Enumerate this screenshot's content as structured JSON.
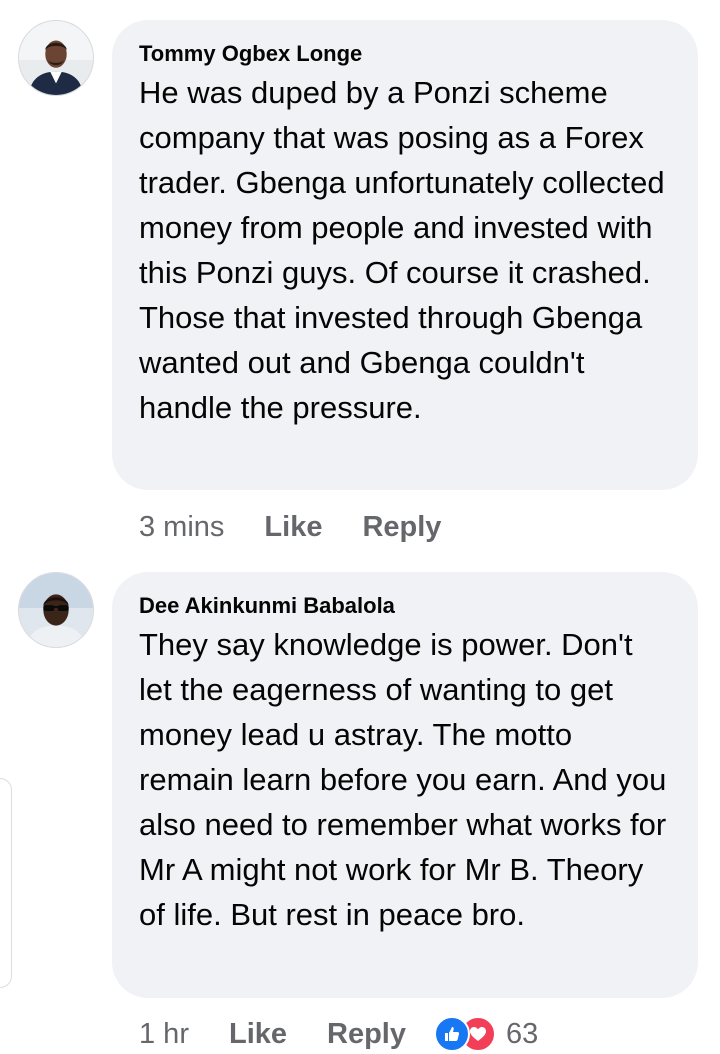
{
  "comments": [
    {
      "author": "Tommy Ogbex Longe",
      "text": "He was duped by a Ponzi scheme company that was posing as a Forex trader. Gbenga unfortunately collected money from people and invested with this Ponzi guys. Of course it crashed. Those that invested through Gbenga wanted out and Gbenga couldn't handle the pressure.",
      "time": "3 mins",
      "like_label": "Like",
      "reply_label": "Reply"
    },
    {
      "author": "Dee Akinkunmi Babalola",
      "text": "They say knowledge is power. Don't let the eagerness of wanting to get money lead u astray. The motto remain learn before you earn. And you also need to remember what works for Mr A might not work for Mr B. Theory of life. But rest in peace bro.",
      "time": "1 hr",
      "like_label": "Like",
      "reply_label": "Reply",
      "reactions": {
        "icons": [
          "like-icon",
          "love-icon"
        ],
        "count": "63"
      }
    }
  ],
  "colors": {
    "bubble": "#f0f2f5",
    "meta_text": "#65676b",
    "like_blue": "#1877f2",
    "love_red": "#f33e58"
  }
}
